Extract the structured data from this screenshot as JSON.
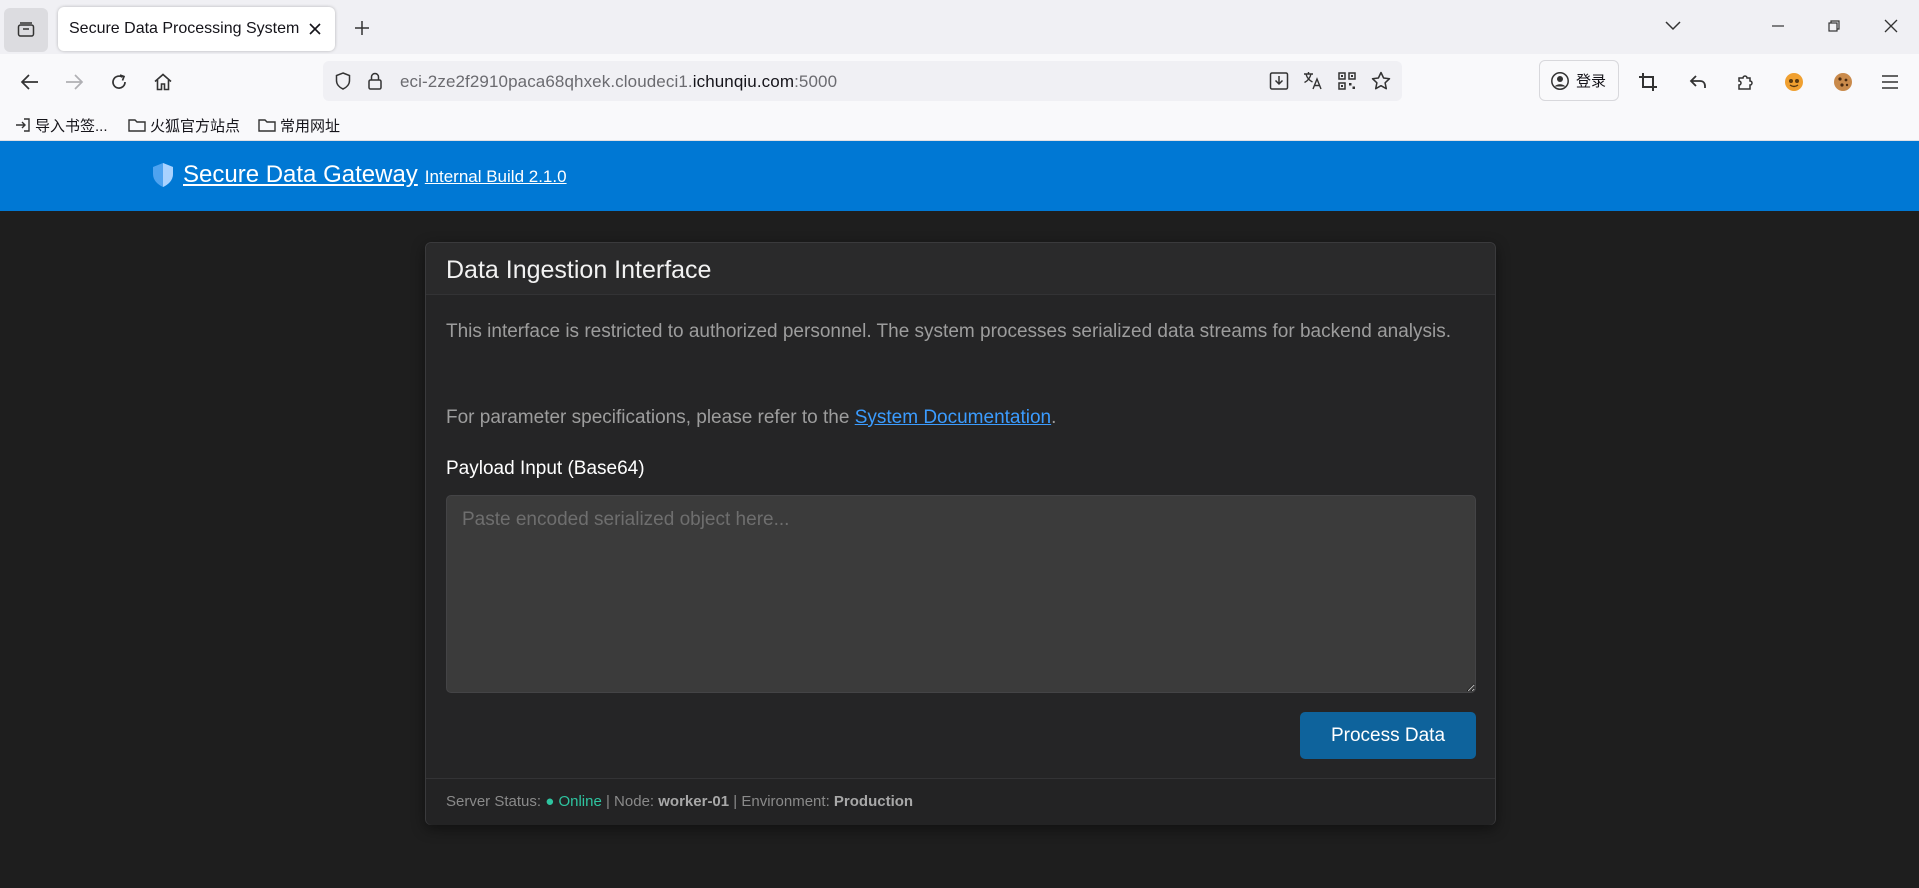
{
  "browser": {
    "tab_title": "Secure Data Processing System",
    "url_prefix": "eci-2ze2f2910paca68qhxek.cloudeci1.",
    "url_host": "ichunqiu.com",
    "url_suffix": ":5000",
    "login_label": "登录",
    "bookmarks": [
      "导入书签...",
      "火狐官方站点",
      "常用网址"
    ]
  },
  "header": {
    "title": "Secure Data Gateway",
    "build": "Internal Build 2.1.0"
  },
  "card": {
    "title": "Data Ingestion Interface",
    "description": "This interface is restricted to authorized personnel. The system processes serialized data streams for backend analysis.",
    "spec_text": "For parameter specifications, please refer to the ",
    "doc_link": "System Documentation",
    "spec_end": ".",
    "field_label": "Payload Input (Base64)",
    "payload_placeholder": "Paste encoded serialized object here...",
    "payload_value": "",
    "submit_label": "Process Data"
  },
  "footer": {
    "status_label": "Server Status:",
    "status_value": "● Online",
    "node_label": "| Node:",
    "node_value": "worker-01",
    "env_label": "| Environment:",
    "env_value": "Production"
  },
  "colors": {
    "header_bg": "#0078d4",
    "page_bg": "#1e1e1e",
    "button_bg": "#0e639c",
    "online": "#2ec4a0",
    "link": "#3b9cff"
  }
}
